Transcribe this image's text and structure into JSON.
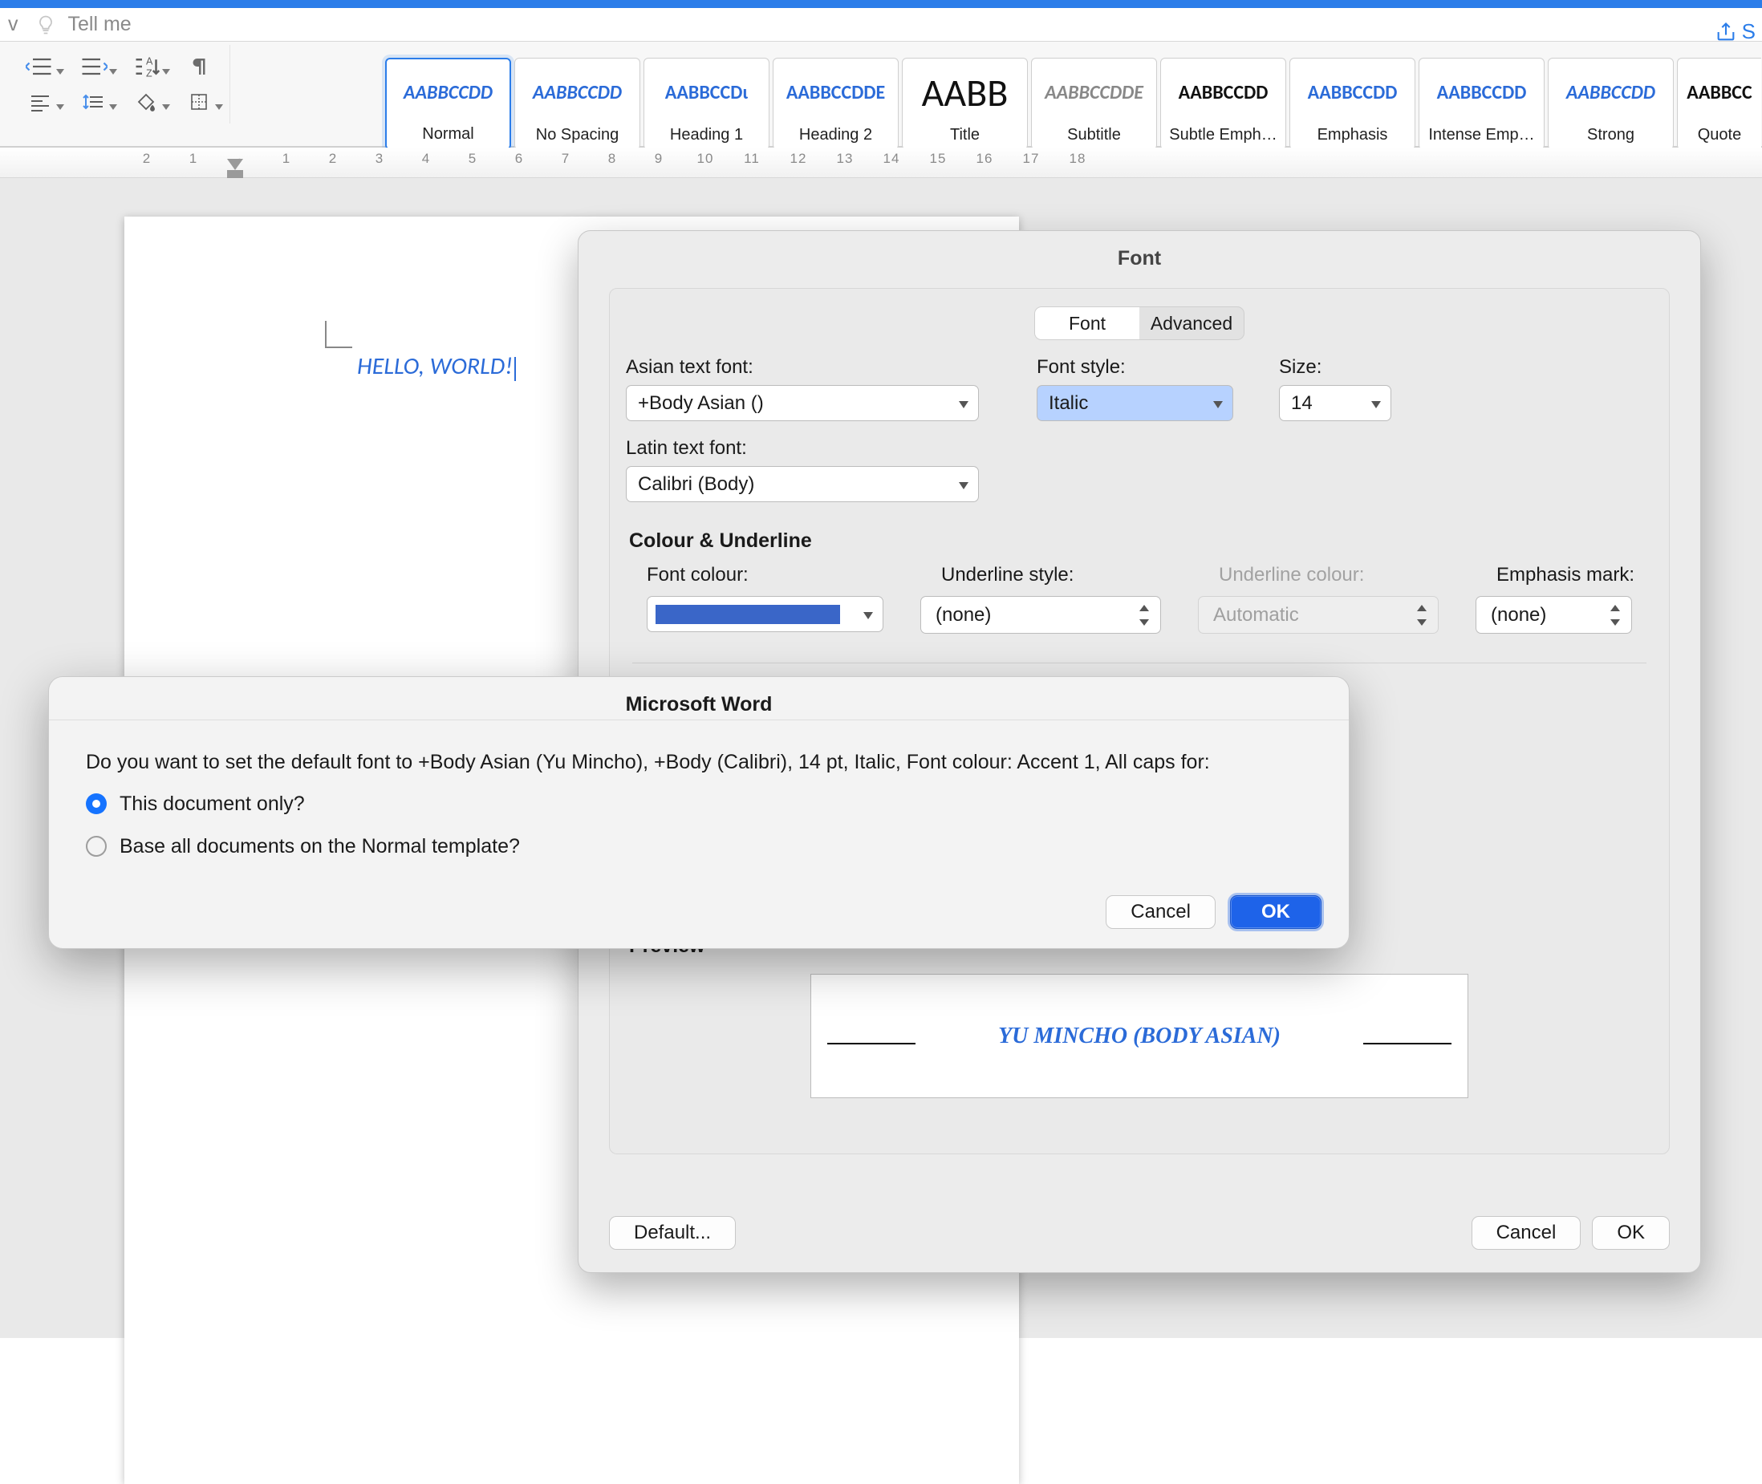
{
  "topbar": {
    "menu_letter": "v",
    "tellme": "Tell me",
    "share_label": "S"
  },
  "styles": [
    {
      "preview": "AABBCCDD",
      "label": "Normal",
      "cls": "blue italic",
      "selected": true
    },
    {
      "preview": "AABBCCDD",
      "label": "No Spacing",
      "cls": "blue italic"
    },
    {
      "preview": "AABBCCDι",
      "label": "Heading 1",
      "cls": "blue"
    },
    {
      "preview": "AABBCCDDE",
      "label": "Heading 2",
      "cls": "blue"
    },
    {
      "preview": "AABB",
      "label": "Title",
      "cls": "black big"
    },
    {
      "preview": "AABBCCDDE",
      "label": "Subtitle",
      "cls": "gray italic"
    },
    {
      "preview": "AABBCCDD",
      "label": "Subtle Emph…",
      "cls": "black"
    },
    {
      "preview": "AABBCCDD",
      "label": "Emphasis",
      "cls": "blue"
    },
    {
      "preview": "AABBCCDD",
      "label": "Intense Emp…",
      "cls": "blue"
    },
    {
      "preview": "AABBCCDD",
      "label": "Strong",
      "cls": "blue italic bold"
    },
    {
      "preview": "AABBCC",
      "label": "Quote",
      "cls": "black"
    }
  ],
  "ruler": [
    "2",
    "1",
    "",
    "1",
    "2",
    "3",
    "4",
    "5",
    "6",
    "7",
    "8",
    "9",
    "10",
    "11",
    "12",
    "13",
    "14",
    "15",
    "16",
    "17",
    "18"
  ],
  "document": {
    "text": "HELLO, WORLD!"
  },
  "fontDialog": {
    "title": "Font",
    "tabs": {
      "font": "Font",
      "advanced": "Advanced"
    },
    "labels": {
      "asian": "Asian text font:",
      "style": "Font style:",
      "size": "Size:",
      "latin": "Latin text font:",
      "section": "Colour & Underline",
      "fontcolour": "Font colour:",
      "ustyle": "Underline style:",
      "ucolour": "Underline colour:",
      "emph": "Emphasis mark:",
      "preview": "Preview",
      "default": "Default...",
      "cancel": "Cancel",
      "ok": "OK"
    },
    "values": {
      "asian": "+Body Asian ()",
      "style": "Italic",
      "size": "14",
      "latin": "Calibri (Body)",
      "ustyle": "(none)",
      "ucolour": "Automatic",
      "emph": "(none)",
      "preview": "YU MINCHO (BODY ASIAN)",
      "colour": "#3a66c8"
    }
  },
  "sheet": {
    "title": "Microsoft Word",
    "question": "Do you want to set the default font to +Body Asian (Yu Mincho), +Body (Calibri), 14 pt, Italic, Font colour: Accent 1, All caps for:",
    "opt1": "This document only?",
    "opt2": "Base all documents on the Normal template?",
    "cancel": "Cancel",
    "ok": "OK"
  }
}
